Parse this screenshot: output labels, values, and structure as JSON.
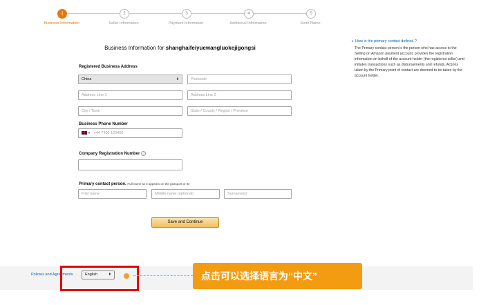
{
  "steps": [
    {
      "number": "1",
      "label": "Business Information"
    },
    {
      "number": "2",
      "label": "Seller Information"
    },
    {
      "number": "3",
      "label": "Payment Information"
    },
    {
      "number": "4",
      "label": "Additional Information"
    },
    {
      "number": "5",
      "label": "Store Name"
    }
  ],
  "form": {
    "title_prefix": "Business Information for",
    "company_name": "shanghaifeiyuewangluokejigongsi",
    "address_section": "Registered Business Address",
    "country": "China",
    "postcode_placeholder": "Postcode",
    "address1_placeholder": "Address Line 1",
    "address2_placeholder": "Address Line 2",
    "city_placeholder": "City / Town",
    "state_placeholder": "State / County / Region / Province",
    "phone_section": "Business Phone Number",
    "phone_placeholder": "+44 7400 123456",
    "registration_section": "Company Registration Number",
    "registration_value": "",
    "contact_section": "Primary contact person.",
    "contact_note": "Full name as it appears on the passport or ID",
    "first_name_placeholder": "First name",
    "middle_name_placeholder": "Middle name (optional)",
    "surname_placeholder": "Surname(s)",
    "save_label": "Save and Continue"
  },
  "aside": {
    "question": "How is the primary contact defined ?",
    "answer": "The Primary contact person is the person who has access to the Selling on Amazon payment account, provides the registration information on behalf of the account holder (the registered seller) and initiates transactions such as disbursements and refunds. Actions taken by the Primary point of contact are deemed to be taken by the account holder."
  },
  "footer": {
    "policies_link": "Policies and Agreements",
    "language_value": "English"
  },
  "annotation": {
    "callout_text": "点击可以选择语言为“中文”"
  },
  "colors": {
    "accent": "#e47911",
    "link": "#0066c0",
    "highlight_box": "#e30000",
    "callout": "#f39c12"
  }
}
